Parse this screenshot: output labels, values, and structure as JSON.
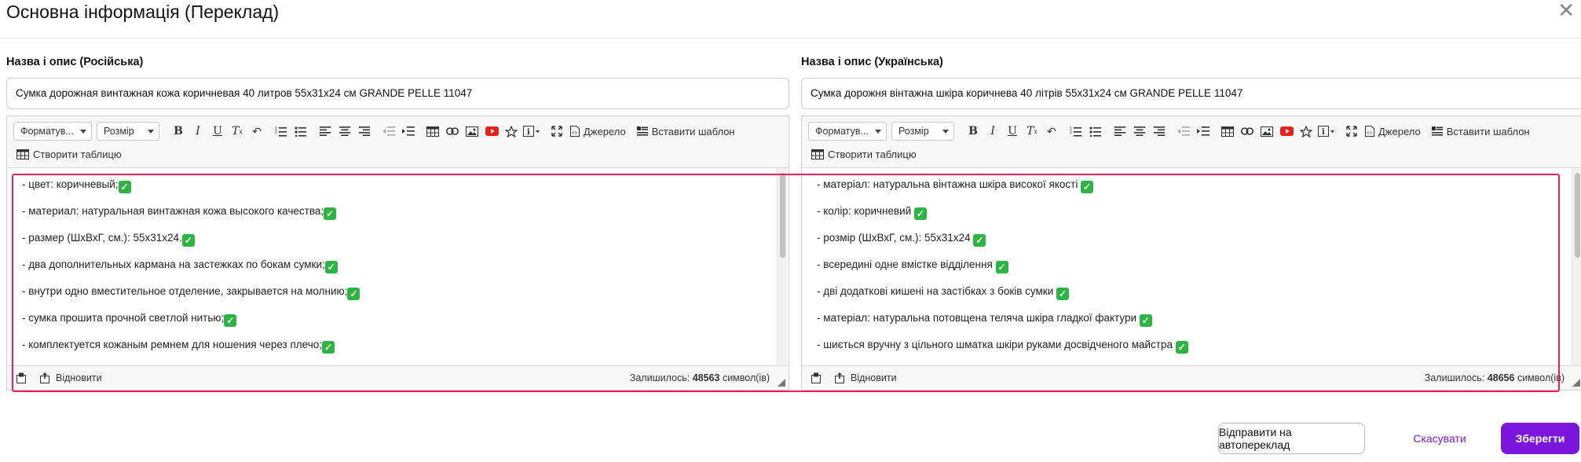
{
  "modal": {
    "title": "Основна інформація (Переклад)",
    "close_icon": "close-icon"
  },
  "toolbar": {
    "format_label": "Форматув...",
    "size_label": "Розмір",
    "source_label": "Джерело",
    "template_label": "Вставити шаблон",
    "create_table_label": "Створити таблицю"
  },
  "left": {
    "label": "Назва і опис (Російська)",
    "title_value": "Сумка дорожная винтажная кожа коричневая 40 литров 55х31х24 см GRANDE PELLE 11047",
    "lines": [
      "- цвет: коричневый;",
      "- материал: натуральная винтажная кожа высокого качества;",
      "- размер (ШхВхГ, см.): 55х31х24.",
      "- два дополнительных кармана на застежках по бокам сумки;",
      "- внутри одно вместительное отделение, закрывается на молнию;",
      "- сумка прошита прочной светлой нитью;",
      "- комплектуется кожаным ремнем для ношения через плечо;"
    ],
    "restore_label": "Відновити",
    "remaining_prefix": "Залишилось:",
    "remaining_count": "48563",
    "remaining_suffix": "символ(ів)"
  },
  "right": {
    "label": "Назва і опис (Українська)",
    "title_value": "Сумка дорожня вінтажна шкіра коричнева 40 літрів 55х31х24 см GRANDE PELLE 11047",
    "lines": [
      "- матеріал: натуральна вінтажна шкіра високої якості ",
      "- колір: коричневий ",
      "- розмір (ШхВхГ, см.): 55х31х24 ",
      "- всередині одне вмістке відділення ",
      "- дві додаткові кишені на застібках з боків сумки ",
      "- матеріал: натуральна потовщена теляча шкіра гладкої фактури ",
      "- шиється вручну з цільного шматка шкіри руками досвідченого майстра "
    ],
    "restore_label": "Відновити",
    "remaining_prefix": "Залишилось:",
    "remaining_count": "48656",
    "remaining_suffix": "символ(ів)"
  },
  "footer": {
    "auto_translate_label": "Відправити на автопереклад",
    "cancel_label": "Скасувати",
    "save_label": "Зберегти"
  },
  "colors": {
    "accent": "#7b16dc",
    "highlight_border": "#e8235c",
    "check": "#2db442"
  }
}
